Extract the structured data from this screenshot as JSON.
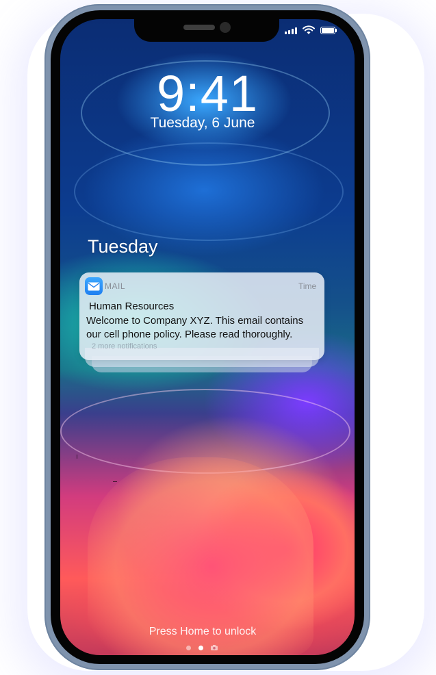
{
  "status_bar": {
    "signal_icon": "cellular-signal-icon",
    "wifi_icon": "wifi-icon",
    "battery_icon": "battery-icon"
  },
  "lock_screen": {
    "time": "9:41",
    "date": "Tuesday, 6 June",
    "day_heading": "Tuesday",
    "unlock_hint": "Press Home to unlock"
  },
  "notification": {
    "app_icon": "mail-icon",
    "app_name": "MAIL",
    "time": "Time",
    "sender": "Human Resources",
    "body": "Welcome to Company XYZ. This email contains our cell phone policy. Please read thoroughly.",
    "more": "2 more notifications"
  },
  "page_indicator": {
    "pages": 2,
    "active_page": 2,
    "camera_icon": "camera-icon"
  },
  "colors": {
    "frame": "#7f93ad",
    "notification_bg": "#e8eef6",
    "mail_icon_blue": "#1f7ff0"
  }
}
